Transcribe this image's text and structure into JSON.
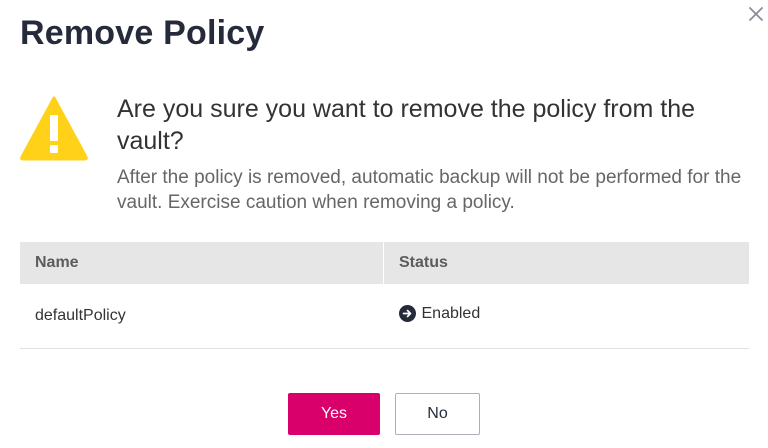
{
  "dialog": {
    "title": "Remove Policy",
    "close_icon": "close-icon",
    "warning_icon": "warning-triangle-icon",
    "question": "Are you sure you want to remove the policy from the vault?",
    "detail": "After the policy is removed, automatic backup will not be performed for the vault. Exercise caution when removing a policy."
  },
  "table": {
    "headers": [
      "Name",
      "Status"
    ],
    "rows": [
      {
        "name": "defaultPolicy",
        "status": "Enabled",
        "status_icon": "arrow-right-circle-icon"
      }
    ]
  },
  "buttons": {
    "yes_label": "Yes",
    "no_label": "No"
  },
  "colors": {
    "primary": "#d9006c",
    "warning": "#ffd119",
    "header_bg": "#e6e6e6"
  }
}
